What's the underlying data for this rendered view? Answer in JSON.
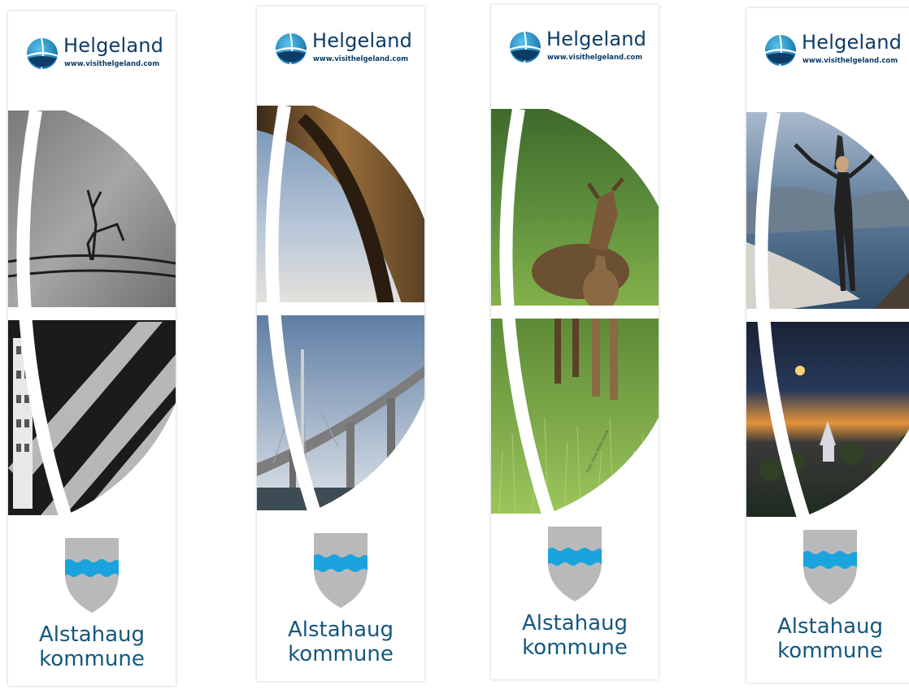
{
  "brand": {
    "name": "Helgeland",
    "url": "www.visithelgeland.com"
  },
  "municipality": {
    "line1": "Alstahaug",
    "line2": "kommune"
  },
  "photo_credit": "Foto: Hans Peter Solvik",
  "colors": {
    "brand_navy": "#0d3c66",
    "text_blue": "#14577f",
    "crest_grey": "#b8b9bb",
    "crest_blue": "#1aa3dc"
  },
  "banners": [
    {
      "id": "petroglyph-architecture"
    },
    {
      "id": "bridge"
    },
    {
      "id": "moose"
    },
    {
      "id": "hiker-sunset"
    }
  ]
}
